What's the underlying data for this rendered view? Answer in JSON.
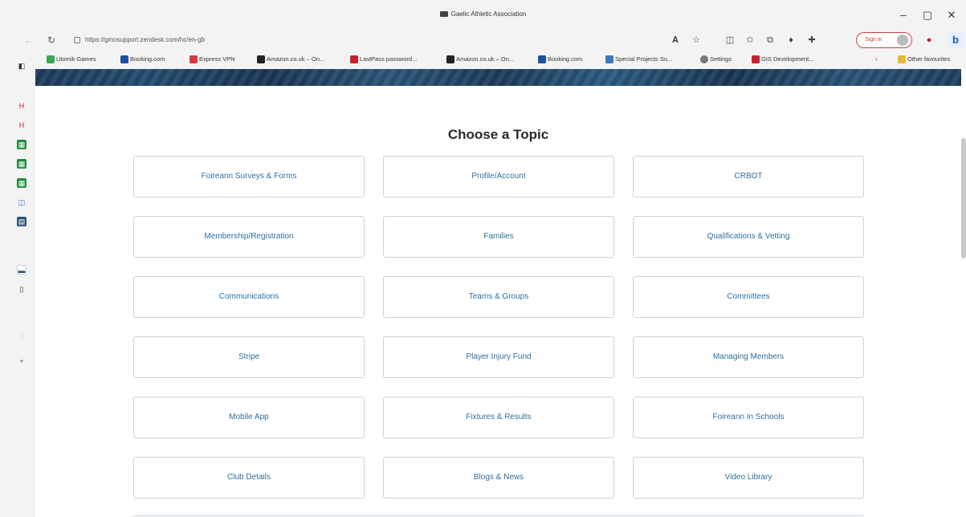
{
  "window": {
    "title": "Gaelic Athletic Association",
    "minimize": "–",
    "maximize": "▢",
    "close": "✕"
  },
  "address": {
    "url": "https://gmosupport.zendesk.com/hc/en-gb",
    "sign_in": "Sign in"
  },
  "bookmarks": [
    {
      "label": "Utomik Games",
      "color": "#3aa655"
    },
    {
      "label": "Booking.com",
      "color": "#1d4fa3"
    },
    {
      "label": "Express VPN",
      "color": "#d9363e"
    },
    {
      "label": "Amazon.co.uk – On...",
      "color": "#222222"
    },
    {
      "label": "LastPass password...",
      "color": "#c8202b"
    },
    {
      "label": "Amazon.co.uk – On...",
      "color": "#222222"
    },
    {
      "label": "Booking.com",
      "color": "#1d4fa3"
    },
    {
      "label": "Special Projects Su...",
      "color": "#3b78c2"
    },
    {
      "label": "Settings",
      "color": "#777777"
    },
    {
      "label": "GIS Development...",
      "color": "#c8202b"
    }
  ],
  "bookmarks_more": "›",
  "other_favourites": "Other favourites",
  "heading": "Choose a Topic",
  "topics": [
    "Foireann Surveys & Forms",
    "Profile/Account",
    "CRBOT",
    "Membership/Registration",
    "Families",
    "Qualifications & Vetting",
    "Communications",
    "Teams & Groups",
    "Committees",
    "Stripe",
    "Player Injury Fund",
    "Managing Members",
    "Mobile App",
    "Fixtures & Results",
    "Foireann In Schools",
    "Club Details",
    "Blogs & News",
    "Video Library"
  ]
}
